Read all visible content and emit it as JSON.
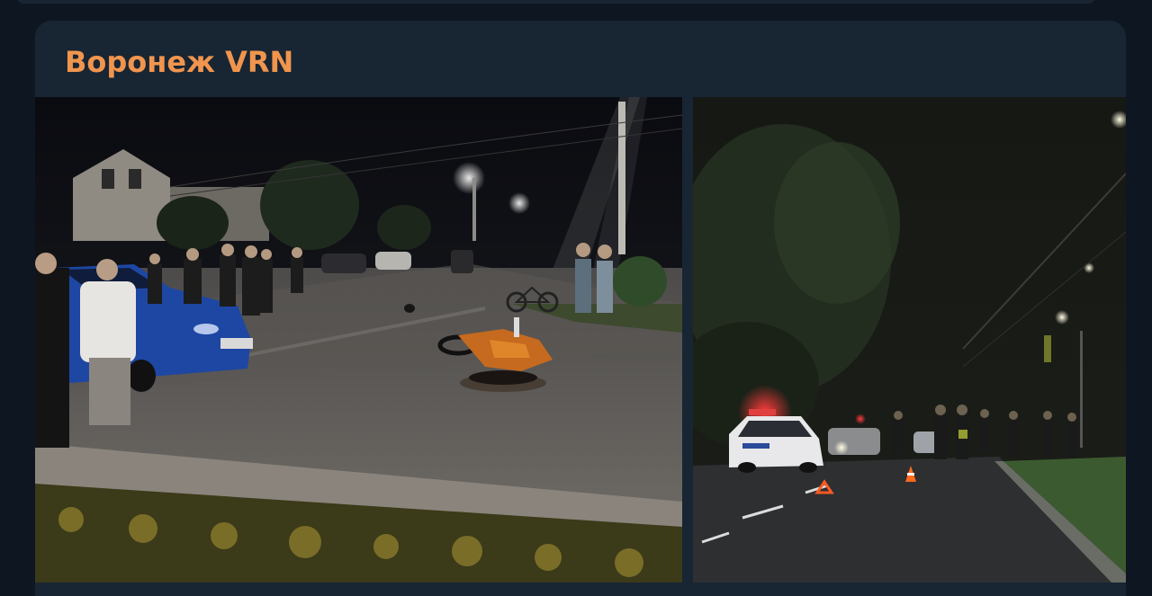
{
  "message": {
    "sender_name": "Воронеж VRN",
    "sender_color": "#f0954e"
  },
  "album": {
    "photos": [
      {
        "name": "photo-accident-scene"
      },
      {
        "name": "photo-police-night-road"
      }
    ]
  }
}
